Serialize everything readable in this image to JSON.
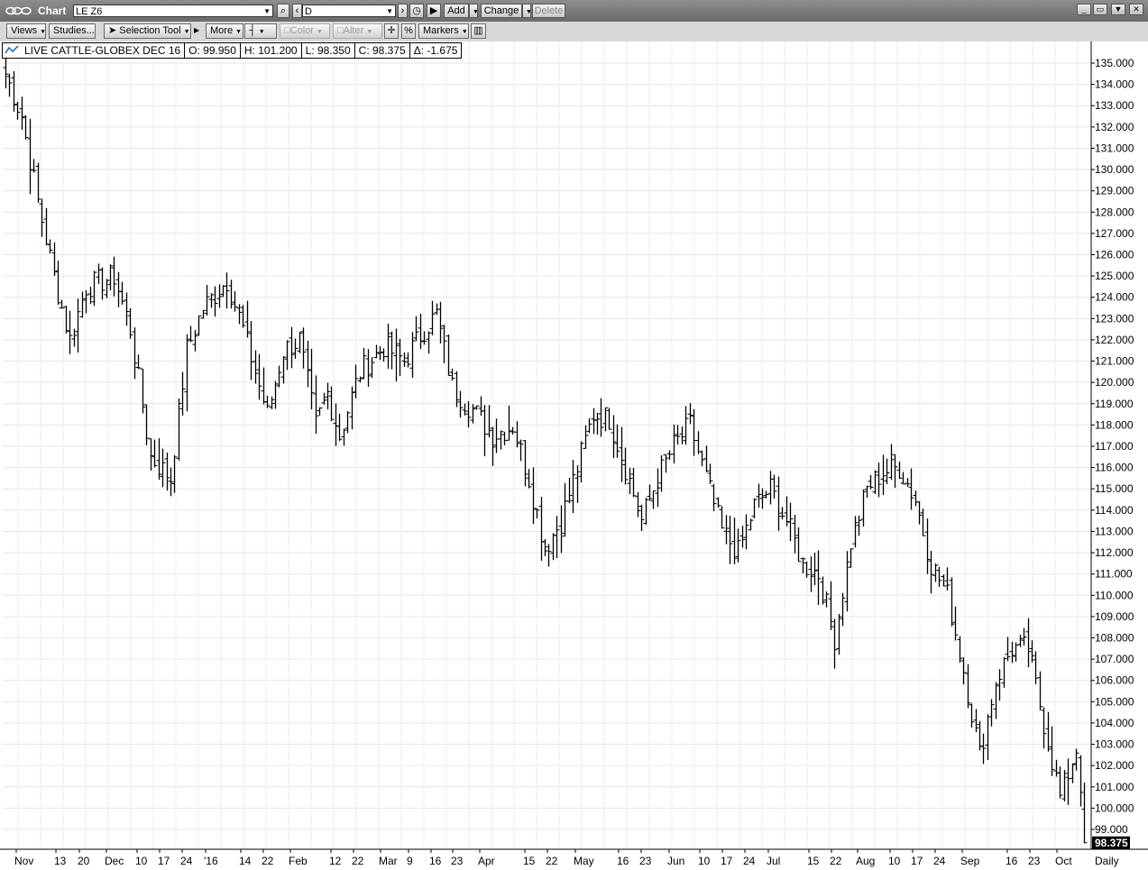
{
  "window": {
    "title": "Chart",
    "symbol_value": "LE Z6",
    "period_value": "D",
    "buttons": {
      "add": "Add",
      "change": "Change",
      "delete": "Delete"
    }
  },
  "toolbar": {
    "views": "Views",
    "studies": "Studies...",
    "selection_tool": "Selection Tool",
    "more": "More",
    "color": "Color",
    "alter": "Alter",
    "percent": "%",
    "markers": "Markers"
  },
  "legend": {
    "name": "LIVE CATTLE-GLOBEX DEC 16",
    "open": "O: 99.950",
    "high": "H: 101.200",
    "low": "L: 98.350",
    "close": "C: 98.375",
    "change": "Δ: -1.675"
  },
  "footer": {
    "interval": "Daily",
    "last_price": "98.375"
  },
  "chart_data": {
    "type": "ohlc-bar",
    "title": "LIVE CATTLE-GLOBEX DEC 16",
    "ylim": [
      98.3,
      135.3
    ],
    "y_ticks": [
      "99.000",
      "100.000",
      "101.000",
      "102.000",
      "103.000",
      "104.000",
      "105.000",
      "106.000",
      "107.000",
      "108.000",
      "109.000",
      "110.000",
      "111.000",
      "112.000",
      "113.000",
      "114.000",
      "115.000",
      "116.000",
      "117.000",
      "118.000",
      "119.000",
      "120.000",
      "121.000",
      "122.000",
      "123.000",
      "124.000",
      "125.000",
      "126.000",
      "127.000",
      "128.000",
      "129.000",
      "130.000",
      "131.000",
      "132.000",
      "133.000",
      "134.000",
      "135.000"
    ],
    "x_labels": [
      "Nov",
      "13",
      "20",
      "Dec",
      "10",
      "17",
      "24",
      "'16",
      "14",
      "22",
      "Feb",
      "12",
      "22",
      "Mar",
      "9",
      "16",
      "23",
      "Apr",
      "15",
      "22",
      "May",
      "16",
      "23",
      "Jun",
      "10",
      "17",
      "24",
      "Jul",
      "15",
      "22",
      "Aug",
      "10",
      "17",
      "24",
      "Sep",
      "16",
      "23",
      "Oct"
    ],
    "y_axis": "right",
    "grid": true,
    "anchors": [
      {
        "bar": 0,
        "value": 134.5
      },
      {
        "bar": 4,
        "value": 132.5
      },
      {
        "bar": 8,
        "value": 128.5
      },
      {
        "bar": 12,
        "value": 125.0
      },
      {
        "bar": 16,
        "value": 122.0
      },
      {
        "bar": 20,
        "value": 124.5
      },
      {
        "bar": 27,
        "value": 125.0
      },
      {
        "bar": 31,
        "value": 122.5
      },
      {
        "bar": 36,
        "value": 116.5
      },
      {
        "bar": 41,
        "value": 115.5
      },
      {
        "bar": 45,
        "value": 121.5
      },
      {
        "bar": 49,
        "value": 123.5
      },
      {
        "bar": 55,
        "value": 124.8
      },
      {
        "bar": 59,
        "value": 122.5
      },
      {
        "bar": 65,
        "value": 118.5
      },
      {
        "bar": 69,
        "value": 121.5
      },
      {
        "bar": 73,
        "value": 122.0
      },
      {
        "bar": 77,
        "value": 118.0
      },
      {
        "bar": 80,
        "value": 119.5
      },
      {
        "bar": 83,
        "value": 117.5
      },
      {
        "bar": 88,
        "value": 120.5
      },
      {
        "bar": 94,
        "value": 121.7
      },
      {
        "bar": 99,
        "value": 121.0
      },
      {
        "bar": 104,
        "value": 122.5
      },
      {
        "bar": 107,
        "value": 123.2
      },
      {
        "bar": 111,
        "value": 119.8
      },
      {
        "bar": 117,
        "value": 118.5
      },
      {
        "bar": 121,
        "value": 117.5
      },
      {
        "bar": 126,
        "value": 118.0
      },
      {
        "bar": 130,
        "value": 115.5
      },
      {
        "bar": 134,
        "value": 112.2
      },
      {
        "bar": 138,
        "value": 113.5
      },
      {
        "bar": 142,
        "value": 116.0
      },
      {
        "bar": 146,
        "value": 118.5
      },
      {
        "bar": 150,
        "value": 118.3
      },
      {
        "bar": 154,
        "value": 116.0
      },
      {
        "bar": 158,
        "value": 113.5
      },
      {
        "bar": 162,
        "value": 115.5
      },
      {
        "bar": 166,
        "value": 117.0
      },
      {
        "bar": 170,
        "value": 118.0
      },
      {
        "bar": 174,
        "value": 115.5
      },
      {
        "bar": 178,
        "value": 113.0
      },
      {
        "bar": 182,
        "value": 112.0
      },
      {
        "bar": 186,
        "value": 114.2
      },
      {
        "bar": 190,
        "value": 115.0
      },
      {
        "bar": 194,
        "value": 113.5
      },
      {
        "bar": 198,
        "value": 111.5
      },
      {
        "bar": 202,
        "value": 111.0
      },
      {
        "bar": 206,
        "value": 108.0
      },
      {
        "bar": 210,
        "value": 112.5
      },
      {
        "bar": 214,
        "value": 115.0
      },
      {
        "bar": 218,
        "value": 115.8
      },
      {
        "bar": 222,
        "value": 116.0
      },
      {
        "bar": 226,
        "value": 114.5
      },
      {
        "bar": 230,
        "value": 111.5
      },
      {
        "bar": 234,
        "value": 110.0
      },
      {
        "bar": 238,
        "value": 106.5
      },
      {
        "bar": 242,
        "value": 102.5
      },
      {
        "bar": 246,
        "value": 106.0
      },
      {
        "bar": 250,
        "value": 107.5
      },
      {
        "bar": 254,
        "value": 107.5
      },
      {
        "bar": 258,
        "value": 104.0
      },
      {
        "bar": 262,
        "value": 100.5
      },
      {
        "bar": 266,
        "value": 102.8
      },
      {
        "bar": 268,
        "value": 99.5
      }
    ],
    "last_bar": {
      "open": 99.95,
      "high": 101.2,
      "low": 98.35,
      "close": 98.375
    }
  }
}
